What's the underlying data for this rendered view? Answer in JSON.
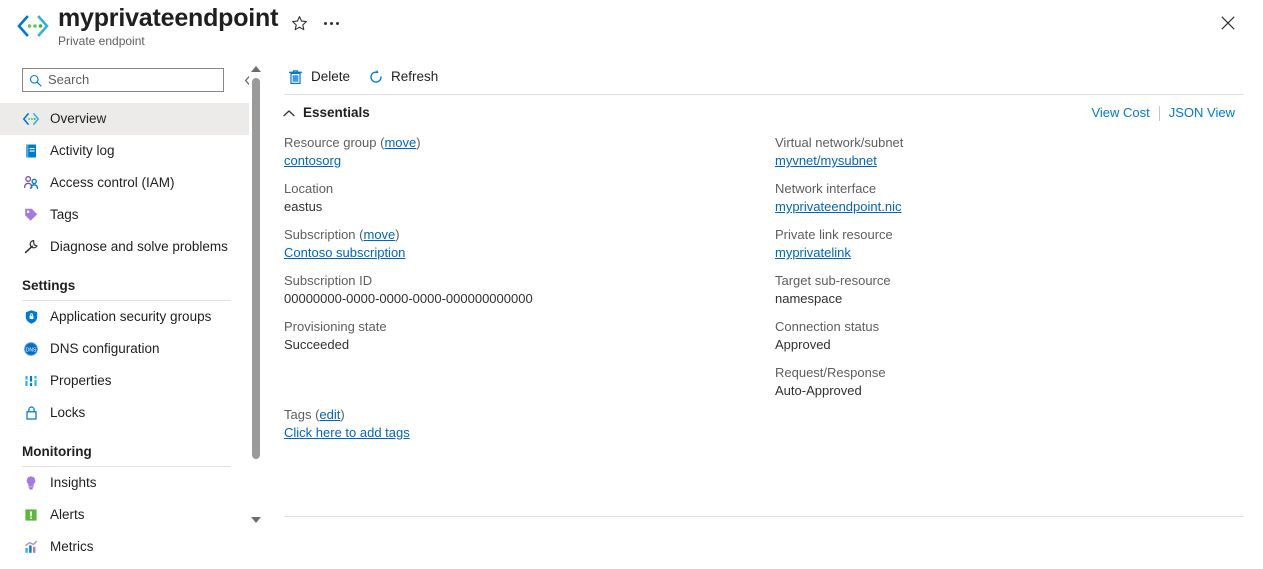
{
  "header": {
    "title": "myprivateendpoint",
    "subtitle": "Private endpoint",
    "resource_icon": "private-endpoint-icon",
    "favorite_icon": "star-icon",
    "more_icon": "ellipsis-icon",
    "close_icon": "close-icon"
  },
  "sidebar": {
    "search": {
      "placeholder": "Search",
      "value": "",
      "icon": "search-icon"
    },
    "collapse_icon": "double-chevron-left-icon",
    "items": [
      {
        "label": "Overview",
        "icon": "private-endpoint-icon",
        "selected": true
      },
      {
        "label": "Activity log",
        "icon": "activity-log-icon",
        "selected": false
      },
      {
        "label": "Access control (IAM)",
        "icon": "access-control-icon",
        "selected": false
      },
      {
        "label": "Tags",
        "icon": "tag-icon",
        "selected": false
      },
      {
        "label": "Diagnose and solve problems",
        "icon": "wrench-icon",
        "selected": false
      }
    ],
    "groups": [
      {
        "title": "Settings",
        "items": [
          {
            "label": "Application security groups",
            "icon": "shield-icon"
          },
          {
            "label": "DNS configuration",
            "icon": "dns-icon"
          },
          {
            "label": "Properties",
            "icon": "properties-icon"
          },
          {
            "label": "Locks",
            "icon": "lock-icon"
          }
        ]
      },
      {
        "title": "Monitoring",
        "items": [
          {
            "label": "Insights",
            "icon": "insights-bulb-icon"
          },
          {
            "label": "Alerts",
            "icon": "alerts-icon"
          },
          {
            "label": "Metrics",
            "icon": "metrics-chart-icon"
          }
        ]
      }
    ],
    "scrollbar": {
      "up_icon": "scroll-up-arrow-icon",
      "down_icon": "scroll-down-arrow-icon"
    }
  },
  "toolbar": {
    "delete_label": "Delete",
    "delete_icon": "trash-icon",
    "refresh_label": "Refresh",
    "refresh_icon": "refresh-icon"
  },
  "essentials": {
    "section_title": "Essentials",
    "collapse_icon": "chevron-up-icon",
    "view_cost_label": "View Cost",
    "json_view_label": "JSON View",
    "left_column": [
      {
        "label": "Resource group",
        "label_suffix_open": " (",
        "label_link": "move",
        "label_suffix_close": ")",
        "value": "contosorg",
        "value_is_link": true
      },
      {
        "label": "Location",
        "value": "eastus",
        "value_is_link": false
      },
      {
        "label": "Subscription",
        "label_suffix_open": " (",
        "label_link": "move",
        "label_suffix_close": ")",
        "value": "Contoso subscription",
        "value_is_link": true
      },
      {
        "label": "Subscription ID",
        "value": "00000000-0000-0000-0000-000000000000",
        "value_is_link": false
      },
      {
        "label": "Provisioning state",
        "value": "Succeeded",
        "value_is_link": false
      }
    ],
    "right_column": [
      {
        "label": "Virtual network/subnet",
        "value": "myvnet/mysubnet",
        "value_is_link": true
      },
      {
        "label": "Network interface",
        "value": "myprivateendpoint.nic",
        "value_is_link": true
      },
      {
        "label": "Private link resource",
        "value": "myprivatelink",
        "value_is_link": true
      },
      {
        "label": "Target sub-resource",
        "value": "namespace",
        "value_is_link": false
      },
      {
        "label": "Connection status",
        "value": "Approved",
        "value_is_link": false
      },
      {
        "label": "Request/Response",
        "value": "Auto-Approved",
        "value_is_link": false
      }
    ],
    "tags": {
      "label": "Tags",
      "label_suffix_open": " (",
      "edit_link": "edit",
      "label_suffix_close": ")",
      "add_link": "Click here to add tags"
    }
  },
  "colors": {
    "azure_blue": "#0078d4",
    "link_blue": "#0067b8",
    "selected_bg": "#edebe9",
    "label_gray": "#605e5c",
    "divider": "#e1dfdd"
  }
}
